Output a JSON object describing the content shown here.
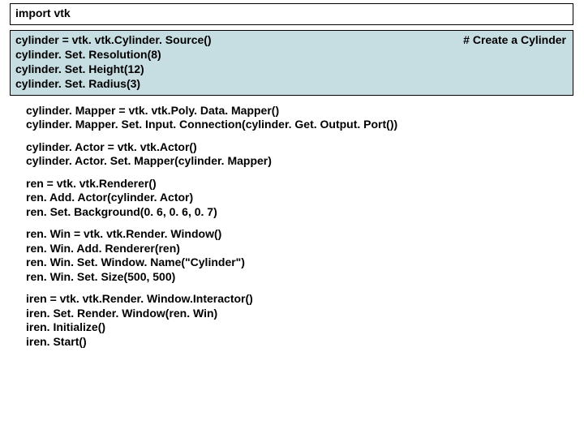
{
  "import_line": "import vtk",
  "comment": "# Create a Cylinder",
  "cylinder_lines": [
    "cylinder = vtk. vtk.Cylinder. Source()",
    "cylinder. Set. Resolution(8)",
    "cylinder. Set. Height(12)",
    "cylinder. Set. Radius(3)"
  ],
  "block1": [
    "cylinder. Mapper = vtk. vtk.Poly. Data. Mapper()",
    "cylinder. Mapper. Set. Input. Connection(cylinder. Get. Output. Port())"
  ],
  "block2": [
    "cylinder. Actor = vtk. vtk.Actor()",
    "cylinder. Actor. Set. Mapper(cylinder. Mapper)"
  ],
  "block3": [
    "ren = vtk. vtk.Renderer()",
    "ren. Add. Actor(cylinder. Actor)",
    "ren. Set. Background(0. 6, 0. 6, 0. 7)"
  ],
  "block4": [
    "ren. Win = vtk. vtk.Render. Window()",
    "ren. Win. Add. Renderer(ren)",
    "ren. Win. Set. Window. Name(\"Cylinder\")",
    "ren. Win. Set. Size(500, 500)"
  ],
  "block5": [
    "iren = vtk. vtk.Render. Window.Interactor()",
    "iren. Set. Render. Window(ren. Win)",
    "iren. Initialize()",
    "iren. Start()"
  ]
}
